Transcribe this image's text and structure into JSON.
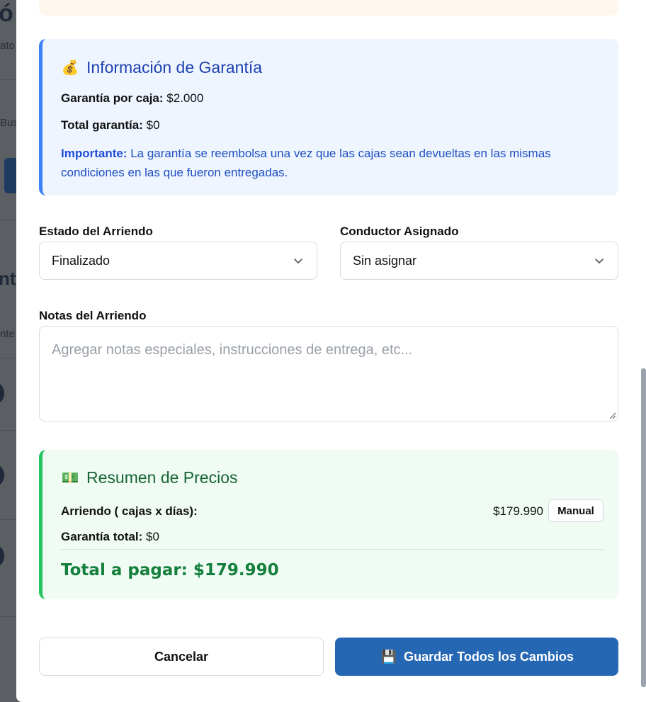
{
  "background": {
    "fragments": [
      "ó",
      "ato",
      "Bus",
      "nt",
      "nte"
    ]
  },
  "guarantee_card": {
    "icon": "money-bag-icon",
    "icon_glyph": "💰",
    "title": "Información de Garantía",
    "per_box_label": "Garantía por caja:",
    "per_box_value": "$2.000",
    "total_label": "Total garantía:",
    "total_value": "$0",
    "important_label": "Importante:",
    "important_text": " La garantía se reembolsa una vez que las cajas sean devueltas en las mismas condiciones en las que fueron entregadas."
  },
  "form": {
    "status_label": "Estado del Arriendo",
    "status_value": "Finalizado",
    "driver_label": "Conductor Asignado",
    "driver_value": "Sin asignar",
    "notes_label": "Notas del Arriendo",
    "notes_placeholder": "Agregar notas especiales, instrucciones de entrega, etc..."
  },
  "price_card": {
    "icon": "money-bill-icon",
    "icon_glyph": "💵",
    "title": "Resumen de Precios",
    "rental_label": "Arriendo ( cajas x días):",
    "rental_value": "$179.990",
    "manual_label": "Manual",
    "guarantee_label": "Garantía total:",
    "guarantee_value": "$0",
    "total_label": "Total a pagar: $179.990"
  },
  "actions": {
    "cancel_label": "Cancelar",
    "save_icon": "floppy-disk-icon",
    "save_glyph": "💾",
    "save_label": "Guardar Todos los Cambios"
  },
  "colors": {
    "primary": "#2567b3",
    "info_accent": "#3b82f6",
    "success_accent": "#22c55e",
    "success_text": "#15803d"
  }
}
